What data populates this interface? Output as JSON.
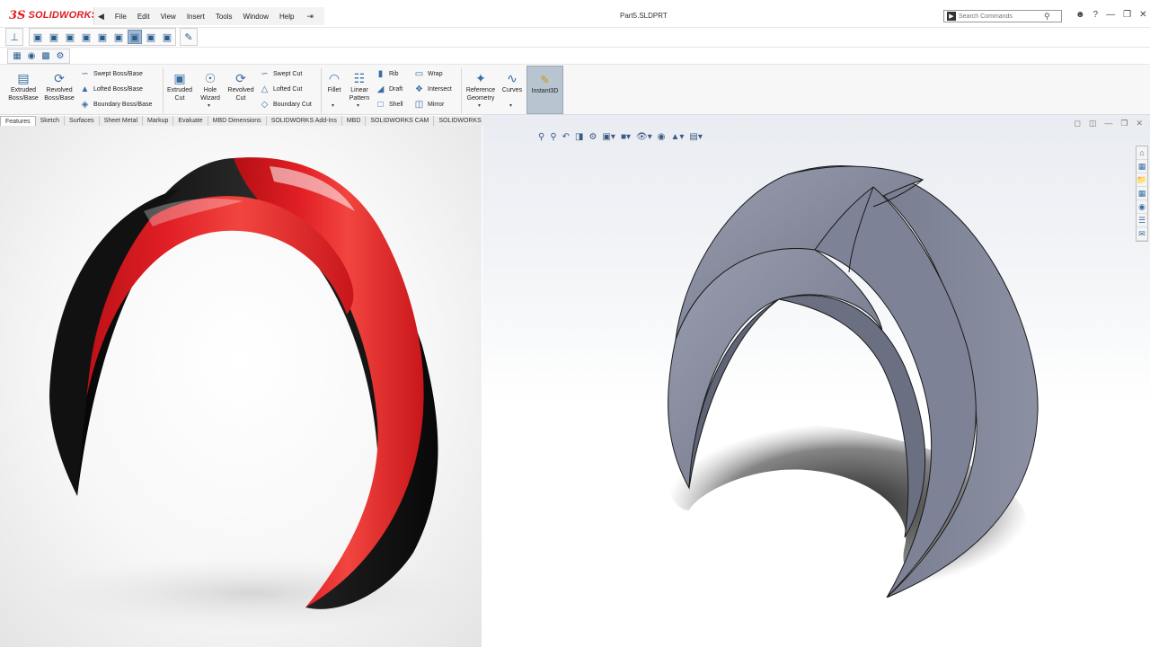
{
  "app": {
    "logo_prefix": "3S",
    "logo_name": "SOLIDWORKS",
    "document_title": "Part5.SLDPRT"
  },
  "menu": {
    "items": [
      "File",
      "Edit",
      "View",
      "Insert",
      "Tools",
      "Window",
      "Help"
    ]
  },
  "search": {
    "placeholder": "Search Commands"
  },
  "ribbon": {
    "extruded_boss": "Extruded\nBoss/Base",
    "revolved_boss": "Revolved\nBoss/Base",
    "swept_boss": "Swept Boss/Base",
    "lofted_boss": "Lofted Boss/Base",
    "boundary_boss": "Boundary Boss/Base",
    "extruded_cut": "Extruded\nCut",
    "hole_wizard": "Hole\nWizard",
    "revolved_cut": "Revolved\nCut",
    "swept_cut": "Swept Cut",
    "lofted_cut": "Lofted Cut",
    "boundary_cut": "Boundary Cut",
    "fillet": "Fillet",
    "linear_pattern": "Linear\nPattern",
    "rib": "Rib",
    "draft": "Draft",
    "shell": "Shell",
    "wrap": "Wrap",
    "intersect": "Intersect",
    "mirror": "Mirror",
    "reference_geometry": "Reference\nGeometry",
    "curves": "Curves",
    "instant3d": "Instant3D"
  },
  "tabs": [
    "Features",
    "Sketch",
    "Surfaces",
    "Sheet Metal",
    "Markup",
    "Evaluate",
    "MBD Dimensions",
    "SOLIDWORKS Add-Ins",
    "MBD",
    "SOLIDWORKS CAM",
    "SOLIDWORKS CAM TBM"
  ],
  "colors": {
    "accent_red": "#e01b22",
    "render_red": "#d8161c",
    "render_black": "#141414",
    "model_gray": "#7a7f92",
    "instant3d_bg": "#b8c4d0"
  }
}
